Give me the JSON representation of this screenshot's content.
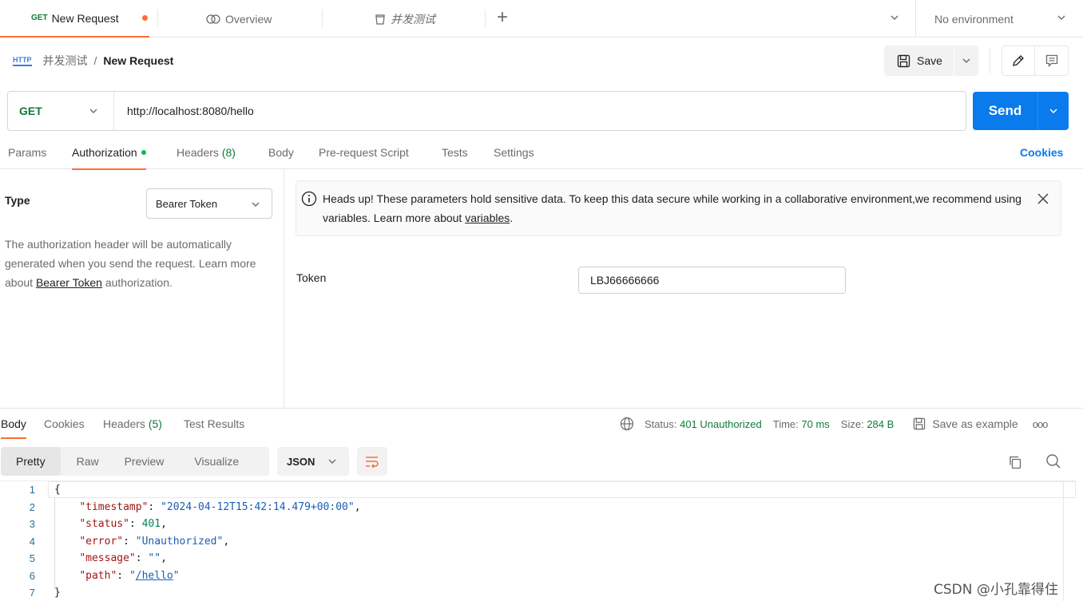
{
  "tabs": [
    {
      "method": "GET",
      "label": "New Request",
      "unsaved": true
    },
    {
      "label": "Overview"
    },
    {
      "label": "并发测试"
    }
  ],
  "environment": {
    "label": "No environment"
  },
  "breadcrumb": {
    "collection": "并发测试",
    "separator": "/",
    "request": "New Request",
    "icon_text": "HTTP"
  },
  "toolbar": {
    "save_label": "Save"
  },
  "request": {
    "method": "GET",
    "url": "http://localhost:8080/hello",
    "send_label": "Send"
  },
  "request_tabs": [
    {
      "label": "Params"
    },
    {
      "label": "Authorization",
      "active": true
    },
    {
      "label": "Headers",
      "count": "(8)"
    },
    {
      "label": "Body"
    },
    {
      "label": "Pre-request Script"
    },
    {
      "label": "Tests"
    },
    {
      "label": "Settings"
    }
  ],
  "cookies_link": "Cookies",
  "auth": {
    "type_label": "Type",
    "type_value": "Bearer Token",
    "desc_prefix": "The authorization header will be automatically generated when you send the request. Learn more about ",
    "desc_link": "Bearer Token",
    "desc_suffix": " authorization.",
    "notice_text": "Heads up! These parameters hold sensitive data. To keep this data secure while working in a collaborative environment,we recommend using variables. Learn more about ",
    "notice_link": "variables",
    "notice_end": ".",
    "token_label": "Token",
    "token_value": "LBJ66666666"
  },
  "response_tabs": [
    {
      "label": "Body",
      "active": true
    },
    {
      "label": "Cookies"
    },
    {
      "label": "Headers",
      "count": "(5)"
    },
    {
      "label": "Test Results"
    }
  ],
  "response_meta": {
    "status_label": "Status:",
    "status_value": "401 Unauthorized",
    "time_label": "Time:",
    "time_value": "70 ms",
    "size_label": "Size:",
    "size_value": "284 B",
    "save_example": "Save as example",
    "more": "ooo"
  },
  "view_modes": [
    {
      "label": "Pretty",
      "active": true
    },
    {
      "label": "Raw"
    },
    {
      "label": "Preview"
    },
    {
      "label": "Visualize"
    }
  ],
  "format": "JSON",
  "body_lines": [
    {
      "n": "1",
      "text": "{"
    },
    {
      "n": "2",
      "key": "\"timestamp\"",
      "value": "\"2024-04-12T15:42:14.479+00:00\"",
      "kind": "str",
      "trail": ","
    },
    {
      "n": "3",
      "key": "\"status\"",
      "value": "401",
      "kind": "num",
      "trail": ","
    },
    {
      "n": "4",
      "key": "\"error\"",
      "value": "\"Unauthorized\"",
      "kind": "str",
      "trail": ","
    },
    {
      "n": "5",
      "key": "\"message\"",
      "value": "\"\"",
      "kind": "str",
      "trail": ","
    },
    {
      "n": "6",
      "key": "\"path\"",
      "value_pre": "\"",
      "value_link": "/hello",
      "value_post": "\"",
      "kind": "link",
      "trail": ""
    },
    {
      "n": "7",
      "text": "}"
    }
  ],
  "watermark": "CSDN @小孔靠得住",
  "colors": {
    "accent": "#ff6c37",
    "send": "#097bed",
    "get": "#0f7b3a",
    "success": "#0cbb52"
  }
}
